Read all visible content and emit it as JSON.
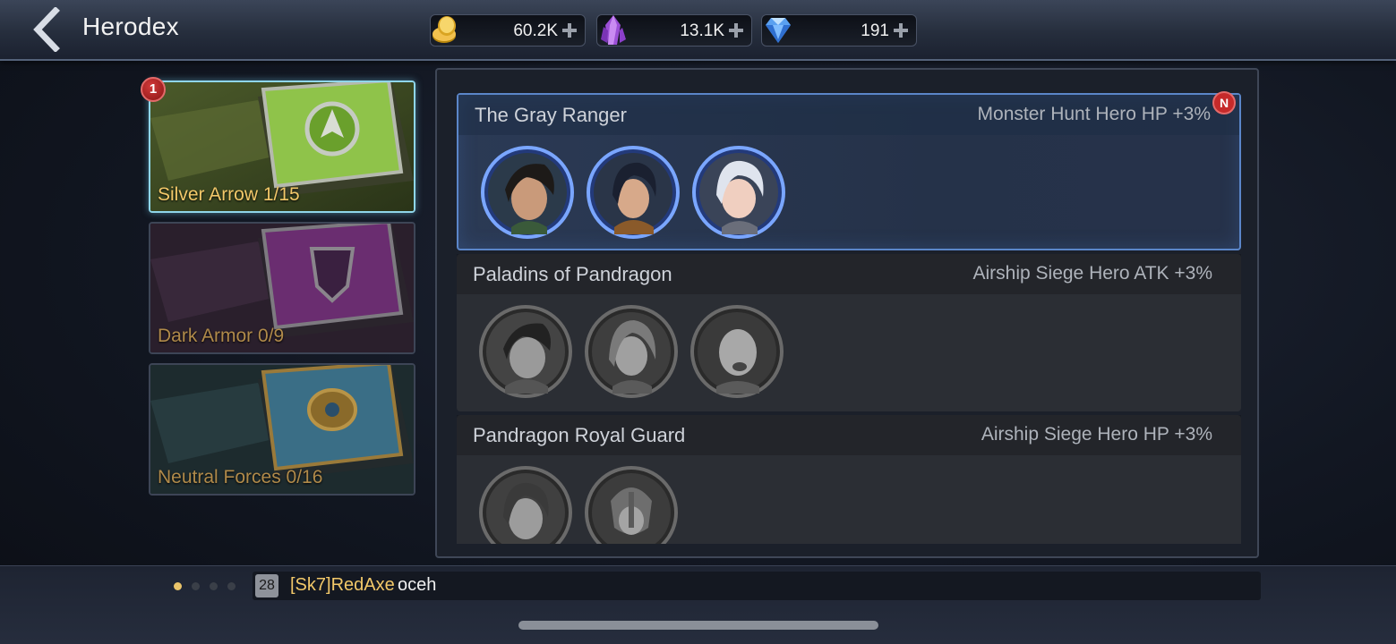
{
  "header": {
    "title": "Herodex",
    "currencies": [
      {
        "name": "gold",
        "amount": "60.2K"
      },
      {
        "name": "crystal",
        "amount": "13.1K"
      },
      {
        "name": "diamond",
        "amount": "191"
      }
    ]
  },
  "books": [
    {
      "label": "Silver Arrow 1/15",
      "badge": "1",
      "selected": true,
      "color": "#7fbf3a"
    },
    {
      "label": "Dark Armor 0/9",
      "selected": false,
      "color": "#8a3a8e"
    },
    {
      "label": "Neutral Forces 0/16",
      "selected": false,
      "color": "#3a8a8e"
    }
  ],
  "sets": [
    {
      "name": "The Gray Ranger",
      "bonus": "Monster Hunt Hero HP +3%",
      "active": true,
      "badge": "N",
      "heroes": 3
    },
    {
      "name": "Paladins of Pandragon",
      "bonus": "Airship Siege Hero ATK +3%",
      "active": false,
      "heroes": 3
    },
    {
      "name": "Pandragon Royal Guard",
      "bonus": "Airship Siege Hero HP +3%",
      "active": false,
      "heroes": 2
    }
  ],
  "chat": {
    "channel": "28",
    "user": "[Sk7]RedAxe",
    "message": "oceh"
  },
  "colors": {
    "accent_gold": "#f2c869",
    "active_border": "#5b86c9",
    "badge_red": "#c62a2a"
  }
}
